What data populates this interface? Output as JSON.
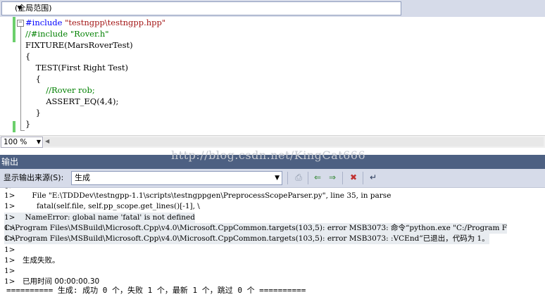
{
  "scope": {
    "value": "(全局范围)"
  },
  "editor": {
    "lines": [
      {
        "parts": [
          {
            "text": "#include ",
            "cls": "kw-pre"
          },
          {
            "text": "\"testngpp\\testngpp.hpp\"",
            "cls": "str"
          }
        ]
      },
      {
        "parts": [
          {
            "text": "//#include \"Rover.h\"",
            "cls": "cmt"
          }
        ]
      },
      {
        "parts": [
          {
            "text": "FIXTURE(MarsRoverTest)",
            "cls": ""
          }
        ]
      },
      {
        "parts": [
          {
            "text": "{",
            "cls": ""
          }
        ]
      },
      {
        "parts": [
          {
            "text": "    TEST(First Right Test)",
            "cls": ""
          }
        ]
      },
      {
        "parts": [
          {
            "text": "    {",
            "cls": ""
          }
        ]
      },
      {
        "parts": [
          {
            "text": "        //Rover rob;",
            "cls": "cmt"
          }
        ]
      },
      {
        "parts": [
          {
            "text": "        ASSERT_EQ(4,4);",
            "cls": ""
          }
        ]
      },
      {
        "parts": [
          {
            "text": "    }",
            "cls": ""
          }
        ]
      },
      {
        "parts": [
          {
            "text": "}",
            "cls": ""
          }
        ]
      }
    ],
    "zoom": "100 %"
  },
  "watermark": "http://blog.csdn.net/KingCat666",
  "output": {
    "title": "输出",
    "source_label": "显示输出来源(S):",
    "source_value": "生成",
    "lines": [
      {
        "num": "1>",
        "text": "    File \"E:\\TDDDev\\testngpp-1.1\\scripts\\testngppgen\\PreprocessScopeParser.py\", line 35, in parse",
        "hl": false
      },
      {
        "num": "1>",
        "text": "      fatal(self.file, self.pp_scope.get_lines()[-1], \\",
        "hl": false
      },
      {
        "num": "1>",
        "text": " NameError: global name 'fatal' is not defined",
        "hl": true
      },
      {
        "num": "1>",
        "text": "C:\\Program Files\\MSBuild\\Microsoft.Cpp\\v4.0\\Microsoft.CppCommon.targets(103,5): error MSB3073: 命令“python.exe \"C:/Program F",
        "hl": true
      },
      {
        "num": "1>",
        "text": "C:\\Program Files\\MSBuild\\Microsoft.Cpp\\v4.0\\Microsoft.CppCommon.targets(103,5): error MSB3073: :VCEnd”已退出，代码为 1。",
        "hl": true
      },
      {
        "num": "1>",
        "text": "",
        "hl": false
      },
      {
        "num": "1>",
        "text": "生成失败。",
        "hl": false
      },
      {
        "num": "1>",
        "text": "",
        "hl": false
      },
      {
        "num": "1>",
        "text": "已用时间 00:00:00.30",
        "hl": false
      }
    ],
    "summary": "========== 生成: 成功 0 个，失败 1 个，最新 1 个，跳过 0 个 =========="
  }
}
